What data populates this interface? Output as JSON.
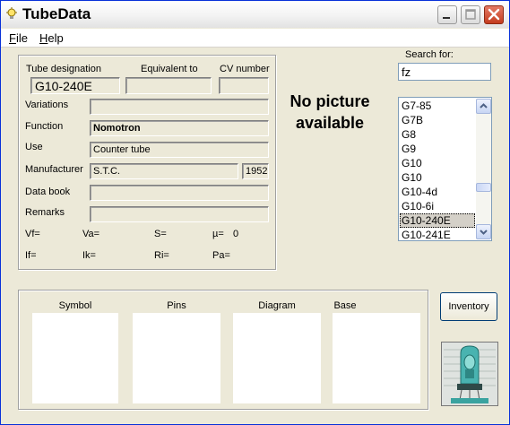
{
  "window": {
    "title": "TubeData"
  },
  "menu": {
    "file": "File",
    "help": "Help"
  },
  "labels": {
    "tube_designation": "Tube designation",
    "equivalent_to": "Equivalent to",
    "cv_number": "CV number",
    "variations": "Variations",
    "function": "Function",
    "use": "Use",
    "manufacturer": "Manufacturer",
    "data_book": "Data book",
    "remarks": "Remarks",
    "vf": "Vf=",
    "va": "Va=",
    "s": "S=",
    "mu": "µ=",
    "if": "If=",
    "ik": "Ik=",
    "ri": "Ri=",
    "pa": "Pa="
  },
  "values": {
    "tube_designation": "G10-240E",
    "equivalent_to": "",
    "cv_number": "",
    "variations": "",
    "function": "Nomotron",
    "use": "Counter tube",
    "manufacturer": "S.T.C.",
    "year": "1952",
    "data_book": "",
    "remarks": "",
    "mu": "0"
  },
  "picture": {
    "text": "No picture available"
  },
  "search": {
    "label": "Search for:",
    "value": "fz"
  },
  "tube_list": {
    "items": [
      "G7-85",
      "G7B",
      "G8",
      "G9",
      "G10",
      "G10",
      "G10-4d",
      "G10-6i",
      "G10-240E",
      "G10-241E"
    ],
    "selected": "G10-240E"
  },
  "bottom_panels": {
    "symbol": "Symbol",
    "pins": "Pins",
    "diagram": "Diagram",
    "base": "Base"
  },
  "buttons": {
    "inventory": "Inventory"
  },
  "colors": {
    "title_text": "#000000",
    "close_button": "#c43c1e",
    "list_selection": "#d4d0c8"
  }
}
